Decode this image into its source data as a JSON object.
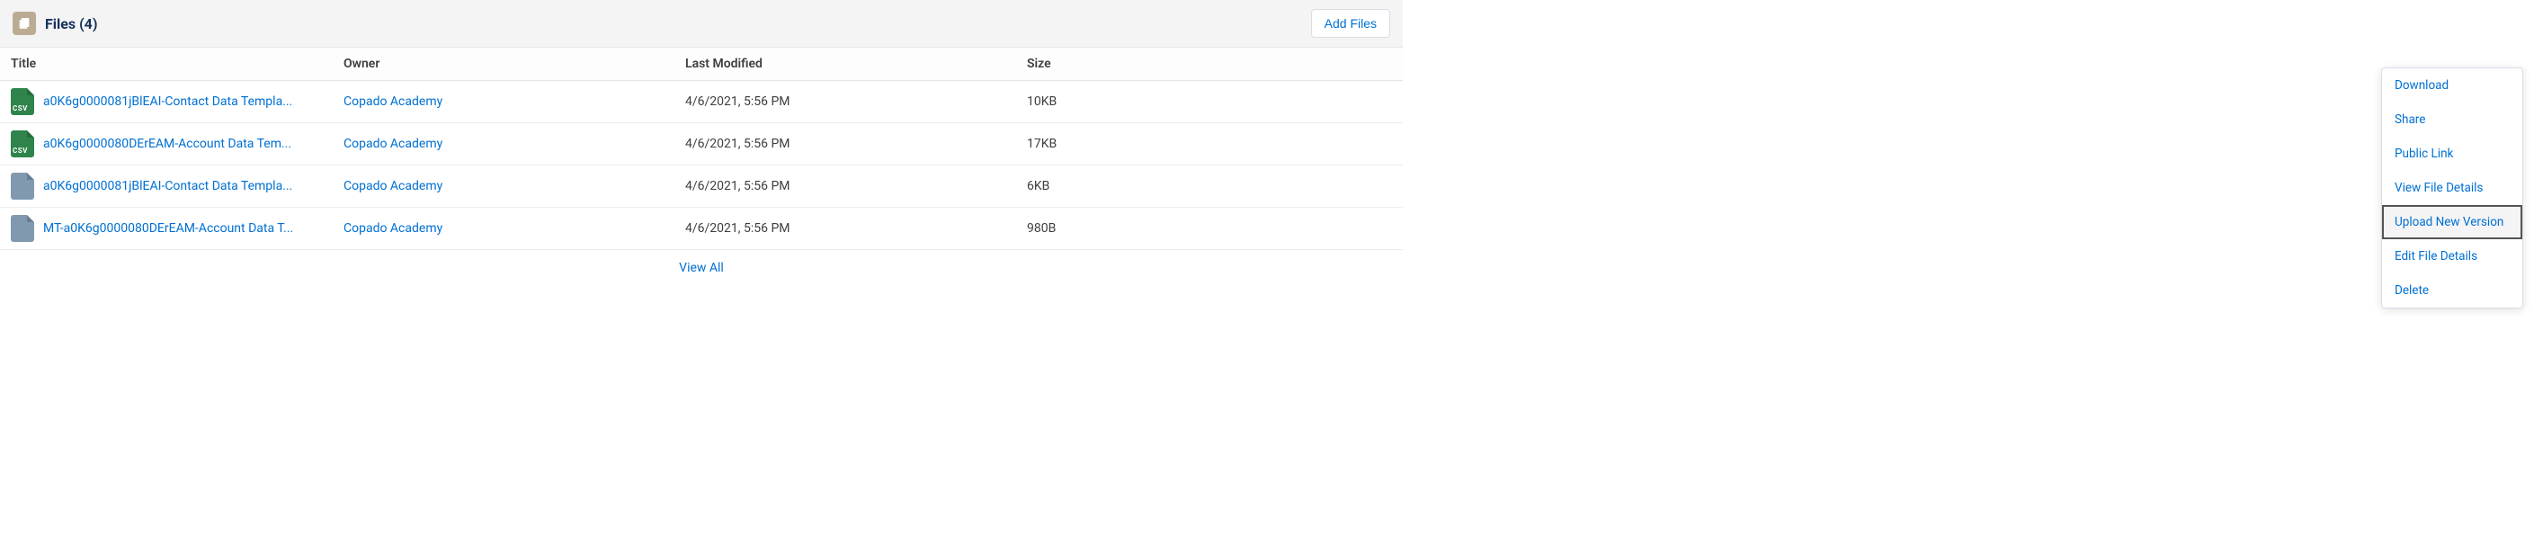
{
  "header": {
    "title": "Files (4)",
    "add_button": "Add Files"
  },
  "columns": {
    "title": "Title",
    "owner": "Owner",
    "last_modified": "Last Modified",
    "size": "Size"
  },
  "rows": [
    {
      "icon": "csv",
      "title": "a0K6g0000081jBlEAI-Contact Data Templa...",
      "owner": "Copado Academy",
      "modified": "4/6/2021, 5:56 PM",
      "size": "10KB"
    },
    {
      "icon": "csv",
      "title": "a0K6g0000080DErEAM-Account Data Tem...",
      "owner": "Copado Academy",
      "modified": "4/6/2021, 5:56 PM",
      "size": "17KB"
    },
    {
      "icon": "generic",
      "title": "a0K6g0000081jBlEAI-Contact Data Templa...",
      "owner": "Copado Academy",
      "modified": "4/6/2021, 5:56 PM",
      "size": "6KB"
    },
    {
      "icon": "generic",
      "title": "MT-a0K6g0000080DErEAM-Account Data T...",
      "owner": "Copado Academy",
      "modified": "4/6/2021, 5:56 PM",
      "size": "980B"
    }
  ],
  "view_all": "View All",
  "menu": {
    "download": "Download",
    "share": "Share",
    "public_link": "Public Link",
    "view_details": "View File Details",
    "upload_version": "Upload New Version",
    "edit_details": "Edit File Details",
    "delete": "Delete"
  }
}
